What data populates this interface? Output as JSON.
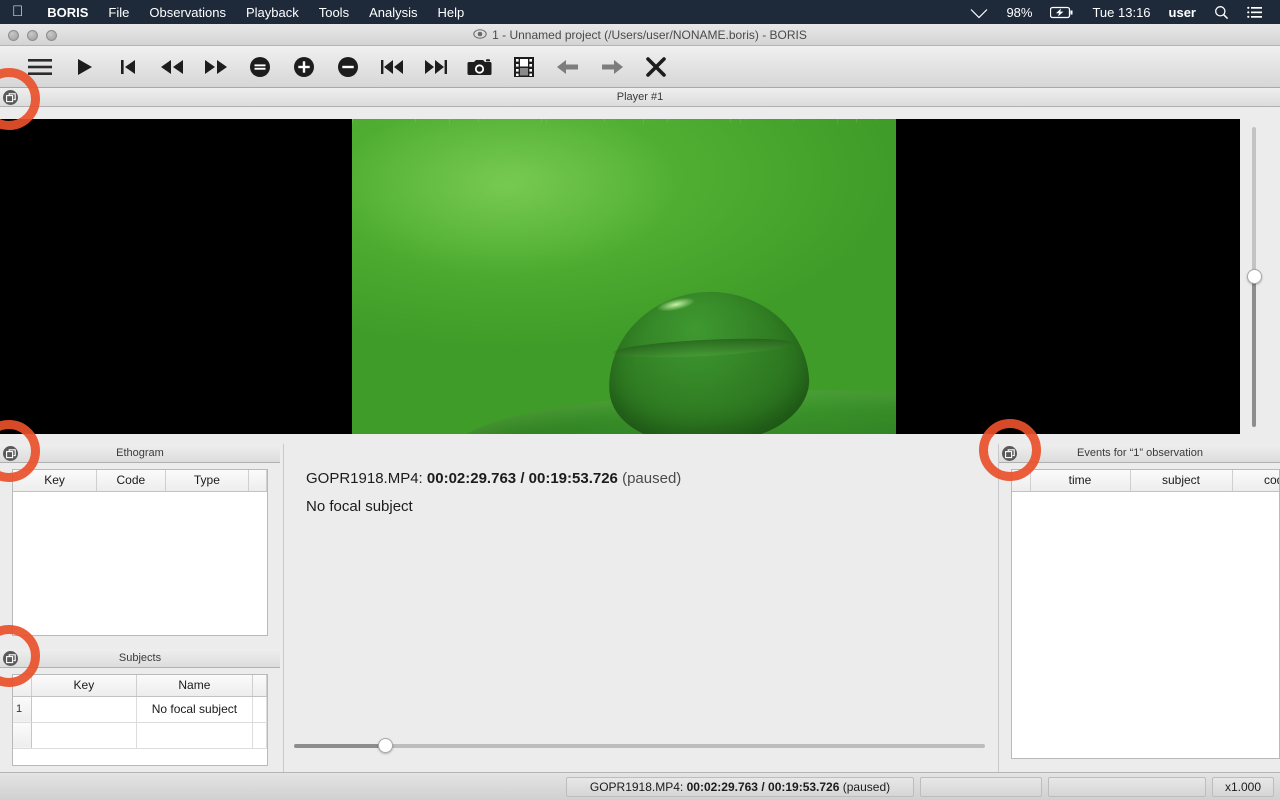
{
  "menubar": {
    "apple_icon": "apple-logo-icon",
    "app_name": "BORIS",
    "items": [
      "File",
      "Observations",
      "Playback",
      "Tools",
      "Analysis",
      "Help"
    ],
    "status": {
      "wifi_icon": "wifi-icon",
      "battery_percent": "98%",
      "battery_icon": "battery-charging-icon",
      "clock": "Tue 13:16",
      "user": "user",
      "search_icon": "search-icon",
      "notification_icon": "notification-list-icon"
    }
  },
  "window": {
    "eye_icon": "eye-icon",
    "title": "1 - Unnamed project (/Users/user/NONAME.boris) - BORIS",
    "traffic_lights": [
      "close",
      "minimize",
      "zoom"
    ]
  },
  "toolbar": {
    "buttons": [
      {
        "name": "menu-button",
        "icon": "hamburger-menu-icon"
      },
      {
        "name": "play-button",
        "icon": "play-icon"
      },
      {
        "name": "jump-to-start-button",
        "icon": "skip-to-start-icon"
      },
      {
        "name": "rewind-button",
        "icon": "rewind-icon"
      },
      {
        "name": "fast-forward-button",
        "icon": "fast-forward-icon"
      },
      {
        "name": "reset-zoom-button",
        "icon": "circle-minus-bar-icon"
      },
      {
        "name": "zoom-in-button",
        "icon": "circle-plus-icon"
      },
      {
        "name": "zoom-out-button",
        "icon": "circle-minus-icon"
      },
      {
        "name": "previous-media-button",
        "icon": "skip-previous-icon"
      },
      {
        "name": "next-media-button",
        "icon": "skip-next-icon"
      },
      {
        "name": "snapshot-button",
        "icon": "camera-icon"
      },
      {
        "name": "frame-by-frame-button",
        "icon": "film-strip-icon"
      },
      {
        "name": "step-back-button",
        "icon": "arrow-left-icon"
      },
      {
        "name": "step-forward-button",
        "icon": "arrow-right-icon"
      },
      {
        "name": "close-observation-button",
        "icon": "close-x-icon"
      }
    ]
  },
  "player": {
    "dock_title": "Player #1",
    "float_icon": "float-window-icon",
    "volume": {
      "value_percent": 50
    }
  },
  "ethogram": {
    "dock_title": "Ethogram",
    "float_icon": "float-window-icon",
    "columns": [
      "Key",
      "Code",
      "Type"
    ],
    "rows": []
  },
  "subjects": {
    "dock_title": "Subjects",
    "float_icon": "float-window-icon",
    "columns": [
      "Key",
      "Name"
    ],
    "rows": [
      {
        "index": "1",
        "key": "",
        "name": "No focal subject"
      }
    ]
  },
  "center": {
    "media_file": "GOPR1918.MP4:",
    "current_time": "00:02:29.763",
    "separator": "/",
    "total_time": "00:19:53.726",
    "play_state": "(paused)",
    "focal_subject": "No focal subject",
    "seek": {
      "position_percent": 13
    }
  },
  "events": {
    "dock_title": "Events for “1” observation",
    "float_icon": "float-window-icon",
    "columns": [
      "time",
      "subject",
      "code"
    ],
    "rows": []
  },
  "statusbar": {
    "media_file": "GOPR1918.MP4:",
    "current_time": "00:02:29.763",
    "separator": "/",
    "total_time": "00:19:53.726",
    "play_state": "(paused)",
    "field_left": "",
    "field_right": "",
    "playback_rate": "x1.000"
  },
  "annotations": {
    "ring_color": "#e8502a",
    "count": 4,
    "targets": [
      "player-float-button",
      "ethogram-float-button",
      "subjects-float-button",
      "events-float-button"
    ]
  }
}
